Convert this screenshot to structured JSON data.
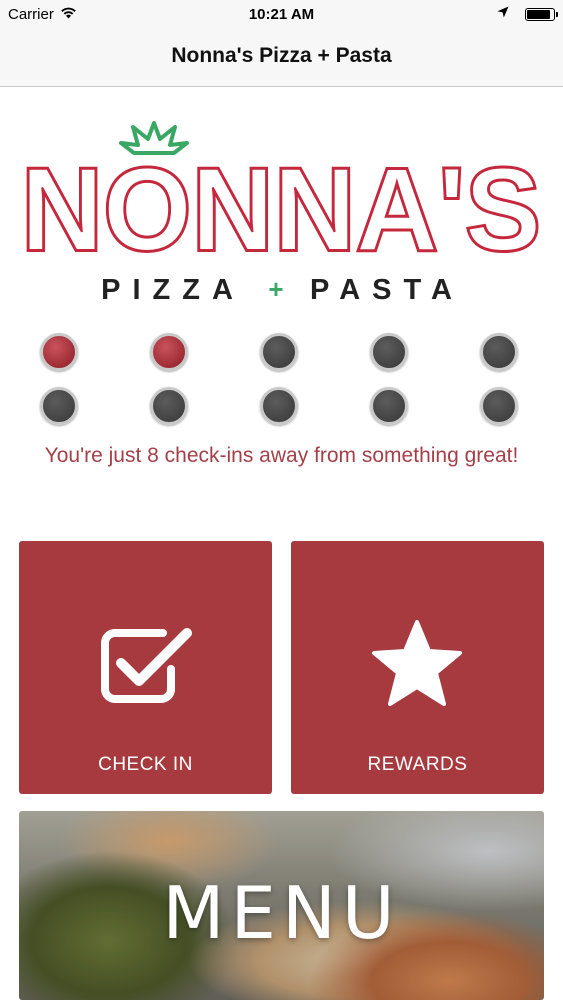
{
  "status_bar": {
    "carrier": "Carrier",
    "time": "10:21 AM",
    "battery_level": 0.95
  },
  "nav": {
    "title": "Nonna's Pizza + Pasta"
  },
  "logo": {
    "name": "NONNA'S",
    "tagline_left": "PIZZA",
    "tagline_plus": "+",
    "tagline_right": "PASTA",
    "brand_red": "#c5283c",
    "brand_green": "#3aa864"
  },
  "punch_card": {
    "total": 10,
    "filled": 2,
    "filled_color": "#9e2c35",
    "empty_color": "#424242",
    "message": "You're just 8 check-ins away from something great!"
  },
  "actions": {
    "check_in": {
      "label": "CHECK IN",
      "icon": "checkbox-icon"
    },
    "rewards": {
      "label": "REWARDS",
      "icon": "star-icon"
    },
    "menu": {
      "label": "MENU"
    }
  },
  "colors": {
    "tile_background": "#a63a3f",
    "message_text": "#a54049"
  }
}
